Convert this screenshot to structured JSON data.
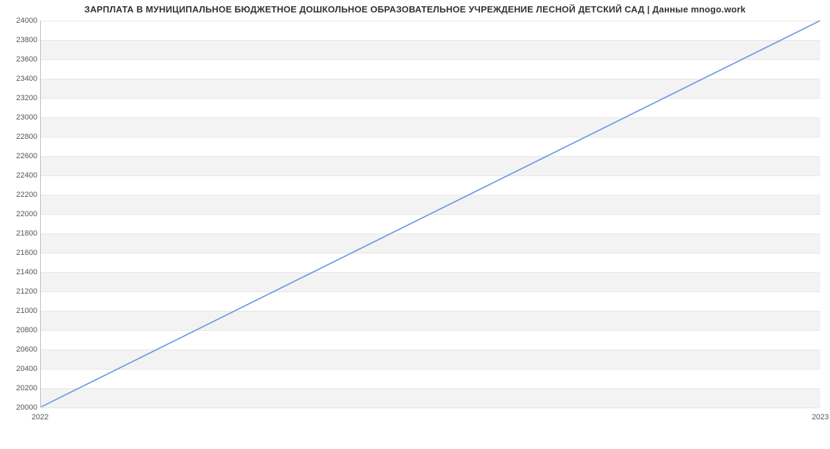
{
  "chart_data": {
    "type": "line",
    "title": "ЗАРПЛАТА В МУНИЦИПАЛЬНОЕ БЮДЖЕТНОЕ ДОШКОЛЬНОЕ ОБРАЗОВАТЕЛЬНОЕ УЧРЕЖДЕНИЕ ЛЕСНОЙ ДЕТСКИЙ САД | Данные mnogo.work",
    "xlabel": "",
    "ylabel": "",
    "x": [
      "2022",
      "2023"
    ],
    "y_ticks": [
      20000,
      20200,
      20400,
      20600,
      20800,
      21000,
      21200,
      21400,
      21600,
      21800,
      22000,
      22200,
      22400,
      22600,
      22800,
      23000,
      23200,
      23400,
      23600,
      23800,
      24000
    ],
    "ylim": [
      20000,
      24000
    ],
    "series": [
      {
        "name": "salary",
        "values": [
          20000,
          24000
        ],
        "color": "#6f9ae6"
      }
    ],
    "grid": true
  }
}
